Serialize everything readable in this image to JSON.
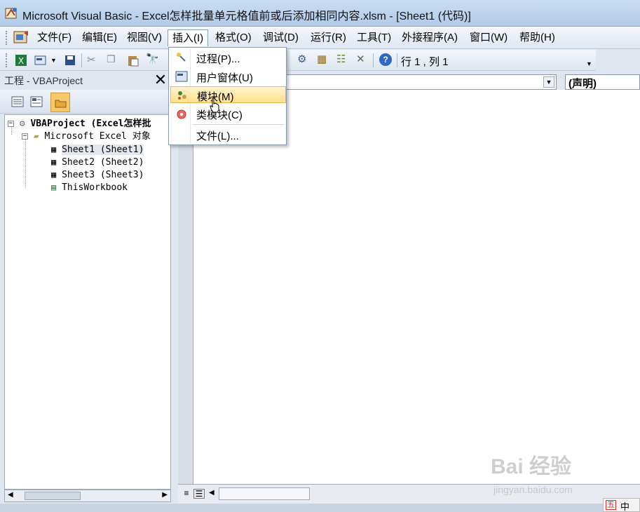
{
  "window": {
    "title": "Microsoft Visual Basic - Excel怎样批量单元格值前或后添加相同内容.xlsm - [Sheet1 (代码)]"
  },
  "menubar": {
    "items": [
      {
        "label": "文件(F)"
      },
      {
        "label": "编辑(E)"
      },
      {
        "label": "视图(V)"
      },
      {
        "label": "插入(I)"
      },
      {
        "label": "格式(O)"
      },
      {
        "label": "调试(D)"
      },
      {
        "label": "运行(R)"
      },
      {
        "label": "工具(T)"
      },
      {
        "label": "外接程序(A)"
      },
      {
        "label": "窗口(W)"
      },
      {
        "label": "帮助(H)"
      }
    ]
  },
  "toolbar": {
    "position_label": "行 1 , 列 1"
  },
  "insert_menu": {
    "items": [
      {
        "label": "过程(P)...",
        "icon": "procedure-icon"
      },
      {
        "label": "用户窗体(U)",
        "icon": "userform-icon"
      },
      {
        "label": "模块(M)",
        "icon": "module-icon",
        "highlighted": true
      },
      {
        "label": "类模块(C)",
        "icon": "class-module-icon"
      },
      {
        "label": "文件(L)...",
        "icon": ""
      }
    ]
  },
  "project_pane": {
    "title": "工程 - VBAProject",
    "close": "✕",
    "tree": [
      {
        "label": "VBAProject (Excel怎样批",
        "level": 0
      },
      {
        "label": "Microsoft Excel 对象",
        "level": 1
      },
      {
        "label": "Sheet1 (Sheet1)",
        "level": 2
      },
      {
        "label": "Sheet2 (Sheet2)",
        "level": 2
      },
      {
        "label": "Sheet3 (Sheet3)",
        "level": 2
      },
      {
        "label": "ThisWorkbook",
        "level": 2
      }
    ]
  },
  "code_window": {
    "object_combo": "",
    "procedure_combo": "(声明)"
  },
  "watermark": {
    "brand": "Bai 经验",
    "url": "jingyan.baidu.com"
  },
  "ime": {
    "label": "中"
  },
  "colors": {
    "highlight": "#ffe08a",
    "titlebar": "#c9dcf3"
  }
}
